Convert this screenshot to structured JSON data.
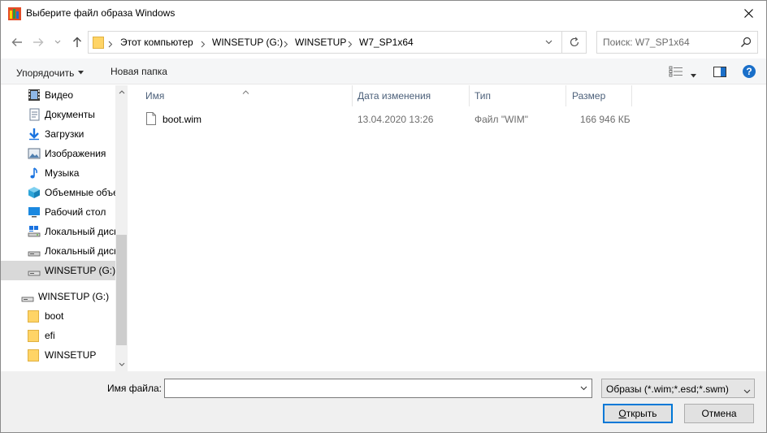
{
  "window": {
    "title": "Выберите файл образа Windows",
    "accent": "#0078d7"
  },
  "address": {
    "crumbs": [
      "Этот компьютер",
      "WINSETUP (G:)",
      "WINSETUP",
      "W7_SP1x64"
    ]
  },
  "search": {
    "placeholder": "Поиск: W7_SP1x64"
  },
  "toolbar": {
    "organize_label": "Упорядочить",
    "new_folder_label": "Новая папка",
    "help_label": "?"
  },
  "sidebar": {
    "items": [
      {
        "label": "Видео",
        "icon": "video-icon"
      },
      {
        "label": "Документы",
        "icon": "documents-icon"
      },
      {
        "label": "Загрузки",
        "icon": "downloads-icon"
      },
      {
        "label": "Изображения",
        "icon": "pictures-icon"
      },
      {
        "label": "Музыка",
        "icon": "music-icon"
      },
      {
        "label": "Объемные объекты",
        "icon": "3d-objects-icon"
      },
      {
        "label": "Рабочий стол",
        "icon": "desktop-icon"
      },
      {
        "label": "Локальный диск (C:)",
        "icon": "network-drive-icon"
      },
      {
        "label": "Локальный диск (D:)",
        "icon": "drive-icon"
      },
      {
        "label": "WINSETUP (G:)",
        "icon": "usb-drive-icon"
      },
      {
        "label": "WINSETUP (G:)",
        "icon": "usb-drive-icon"
      },
      {
        "label": "boot",
        "icon": "folder-icon"
      },
      {
        "label": "efi",
        "icon": "folder-icon"
      },
      {
        "label": "WINSETUP",
        "icon": "folder-icon"
      }
    ],
    "selected_index": 9
  },
  "filelist": {
    "columns": [
      "Имя",
      "Дата изменения",
      "Тип",
      "Размер"
    ],
    "rows": [
      {
        "name": "boot.wim",
        "modified": "13.04.2020 13:26",
        "type": "Файл \"WIM\"",
        "size": "166 946 КБ"
      }
    ]
  },
  "footer": {
    "filename_label": "Имя файла:",
    "filename_value": "",
    "filter_value": "Образы (*.wim;*.esd;*.swm)",
    "open_label_u": "О",
    "open_label_rest": "ткрыть",
    "cancel_label": "Отмена"
  }
}
